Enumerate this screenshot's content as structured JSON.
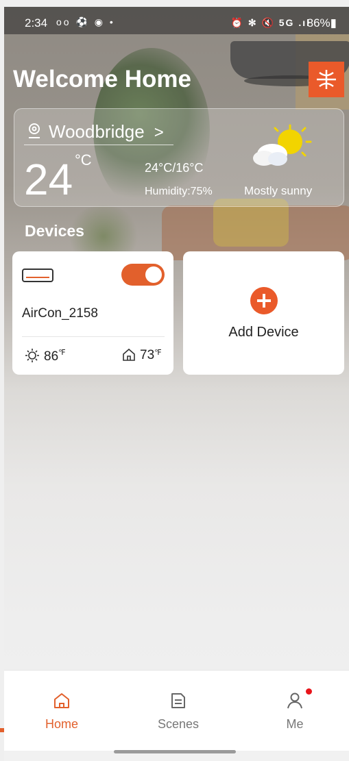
{
  "status_bar": {
    "time": "2:34",
    "left_icons": "oo ⚽ ◉ •",
    "right_icons": "⏰ ✻ 🔇 5G .ıl",
    "battery": "86%▮"
  },
  "header": {
    "title": "Welcome Home"
  },
  "weather": {
    "location": "Woodbridge",
    "temperature": "24",
    "unit": "°C",
    "range": "24°C/16°C",
    "humidity": "Humidity:75%",
    "condition": "Mostly sunny"
  },
  "devices": {
    "title": "Devices",
    "items": [
      {
        "name": "AirCon_2158",
        "power_on": true,
        "outdoor_temp": "86",
        "indoor_temp": "73",
        "temp_unit": "℉"
      }
    ],
    "add_label": "Add Device"
  },
  "nav": {
    "items": [
      {
        "label": "Home",
        "active": true
      },
      {
        "label": "Scenes",
        "active": false
      },
      {
        "label": "Me",
        "active": false
      }
    ]
  },
  "colors": {
    "accent": "#e2602c",
    "notification": "#e8141a"
  }
}
